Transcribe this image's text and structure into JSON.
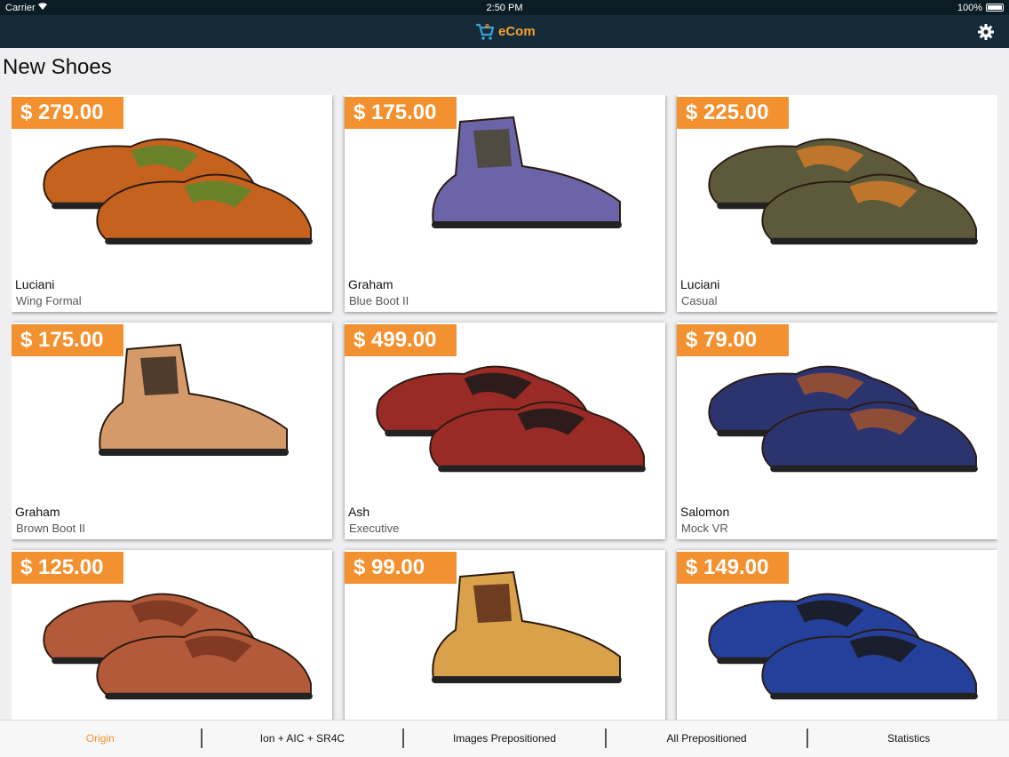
{
  "status_bar": {
    "carrier": "Carrier",
    "time": "2:50 PM",
    "battery": "100%"
  },
  "app": {
    "logo_text": "eCom",
    "brand_color": "#f39130",
    "nav_color": "#152c38"
  },
  "page": {
    "title": "New Shoes"
  },
  "products": [
    {
      "price": "$ 279.00",
      "brand": "Luciani",
      "model": "Wing Formal",
      "image": "orange-green-wingtip-oxfords",
      "color": "#c4621e",
      "accent": "#5a8a2e"
    },
    {
      "price": "$ 175.00",
      "brand": "Graham",
      "model": "Blue Boot II",
      "image": "purple-blue-lace-boot",
      "color": "#6c64a8",
      "accent": "#4a4530"
    },
    {
      "price": "$ 225.00",
      "brand": "Luciani",
      "model": "Casual",
      "image": "green-brown-brogue-oxfords",
      "color": "#5c5a3a",
      "accent": "#d07a2a"
    },
    {
      "price": "$ 175.00",
      "brand": "Graham",
      "model": "Brown Boot II",
      "image": "tan-suede-lace-boot",
      "color": "#d49a6a",
      "accent": "#3a2a1e"
    },
    {
      "price": "$ 499.00",
      "brand": "Ash",
      "model": "Executive",
      "image": "red-monk-strap-shoes",
      "color": "#9a2a25",
      "accent": "#1a1a1a"
    },
    {
      "price": "$ 79.00",
      "brand": "Salomon",
      "model": "Mock VR",
      "image": "navy-suede-loafers",
      "color": "#2c3470",
      "accent": "#a0522d"
    },
    {
      "price": "$ 125.00",
      "brand": "",
      "model": "",
      "image": "brown-leather-loafers",
      "color": "#b35a3a",
      "accent": "#7a3522"
    },
    {
      "price": "$ 99.00",
      "brand": "",
      "model": "",
      "image": "wheat-work-boot",
      "color": "#d9a24a",
      "accent": "#5a2a1a"
    },
    {
      "price": "$ 149.00",
      "brand": "",
      "model": "",
      "image": "blue-suede-buckle-boots",
      "color": "#25409a",
      "accent": "#1a1a1a"
    }
  ],
  "tabs": [
    {
      "label": "Origin",
      "active": true
    },
    {
      "label": "Ion + AIC + SR4C",
      "active": false
    },
    {
      "label": "Images Prepositioned",
      "active": false
    },
    {
      "label": "All Prepositioned",
      "active": false
    },
    {
      "label": "Statistics",
      "active": false
    }
  ]
}
